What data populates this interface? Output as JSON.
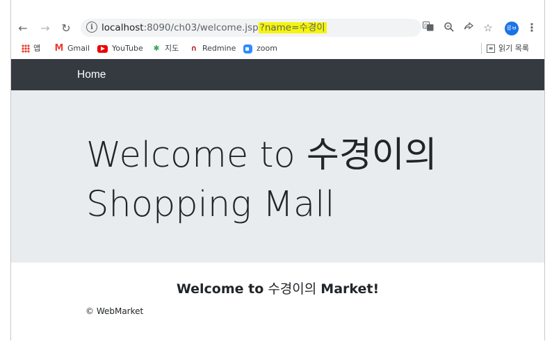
{
  "browser": {
    "url_host": "localhost",
    "url_path": ":8090/ch03/welcome.jsp",
    "url_query": "?name=수경이",
    "profile_label": "류ㅂ"
  },
  "bookmarks": {
    "items": [
      {
        "label": "앱",
        "icon": "apps-grid-icon"
      },
      {
        "label": "Gmail",
        "icon": "gmail-icon"
      },
      {
        "label": "YouTube",
        "icon": "youtube-icon"
      },
      {
        "label": "지도",
        "icon": "maps-pin-icon"
      },
      {
        "label": "Redmine",
        "icon": "redmine-icon"
      },
      {
        "label": "zoom",
        "icon": "zoom-icon"
      }
    ],
    "reading_list": "읽기 목록"
  },
  "page": {
    "nav_brand": "Home",
    "jumbotron_line1": "Welcome to 수경이의",
    "jumbotron_line2": "Shopping Mall",
    "greeting_prefix": "Welcome to",
    "greeting_name": "수경이의",
    "greeting_suffix": "Market!",
    "footer": "© WebMarket"
  },
  "colors": {
    "navbar": "#343a40",
    "jumbotron": "#e9ecef",
    "query_highlight": "#f5f50a"
  }
}
